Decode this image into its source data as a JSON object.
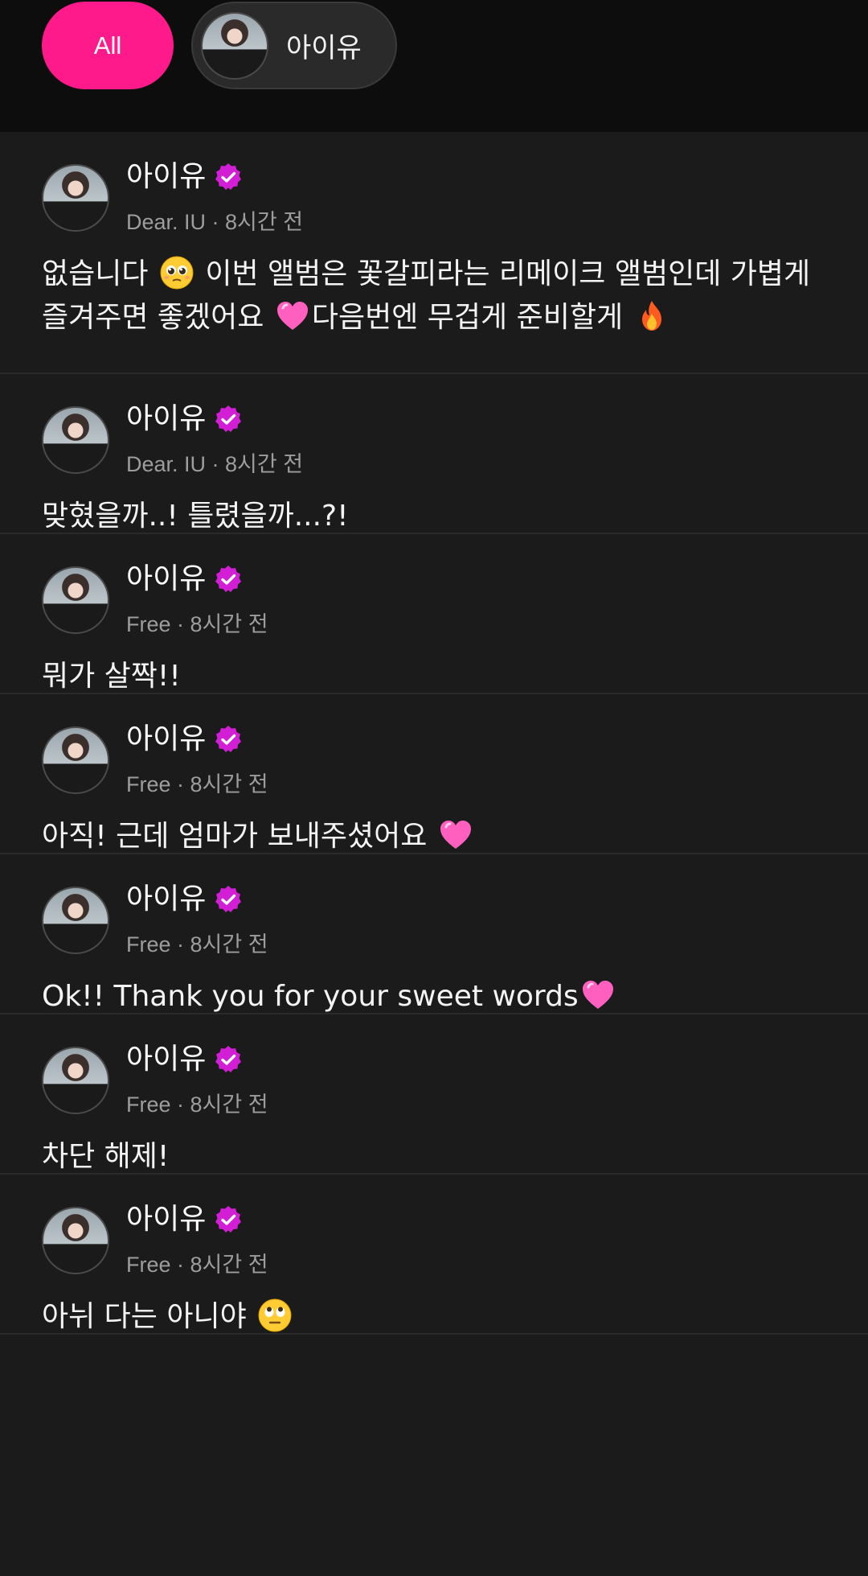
{
  "filters": {
    "all_label": "All",
    "artist_label": "아이유"
  },
  "colors": {
    "accent": "#ff1a8c",
    "verified": "#d21fd6",
    "background": "#1b1b1c",
    "topbar": "#0d0d0e"
  },
  "posts": [
    {
      "author": "아이유",
      "meta": "Dear. IU · 8시간 전",
      "segments": [
        {
          "text": "없습니다 "
        },
        {
          "emoji": "pleading-face-emoji"
        },
        {
          "text": " 이번 앨범은 꽃갈피라는 리메이크 앨범인데 가볍게 즐겨주면 좋겠어요 "
        },
        {
          "emoji": "pink-heart-emoji"
        },
        {
          "text": "다음번엔 무겁게 준비할게 "
        },
        {
          "emoji": "fire-emoji"
        }
      ]
    },
    {
      "author": "아이유",
      "meta": "Dear. IU · 8시간 전",
      "segments": [
        {
          "text": "맞혔을까..! 틀렸을까...?!"
        }
      ]
    },
    {
      "author": "아이유",
      "meta": "Free · 8시간 전",
      "segments": [
        {
          "text": "뭐가 살짝!!"
        }
      ]
    },
    {
      "author": "아이유",
      "meta": "Free · 8시간 전",
      "segments": [
        {
          "text": "아직! 근데 엄마가 보내주셨어요 "
        },
        {
          "emoji": "pink-heart-emoji"
        }
      ]
    },
    {
      "author": "아이유",
      "meta": "Free · 8시간 전",
      "segments": [
        {
          "text": "Ok!! Thank you for your sweet words"
        },
        {
          "emoji": "pink-heart-emoji"
        }
      ]
    },
    {
      "author": "아이유",
      "meta": "Free · 8시간 전",
      "segments": [
        {
          "text": "차단 해제!"
        }
      ]
    },
    {
      "author": "아이유",
      "meta": "Free · 8시간 전",
      "segments": [
        {
          "text": "아뉘 다는 아니야 "
        },
        {
          "emoji": "rolling-eyes-emoji"
        }
      ]
    }
  ]
}
